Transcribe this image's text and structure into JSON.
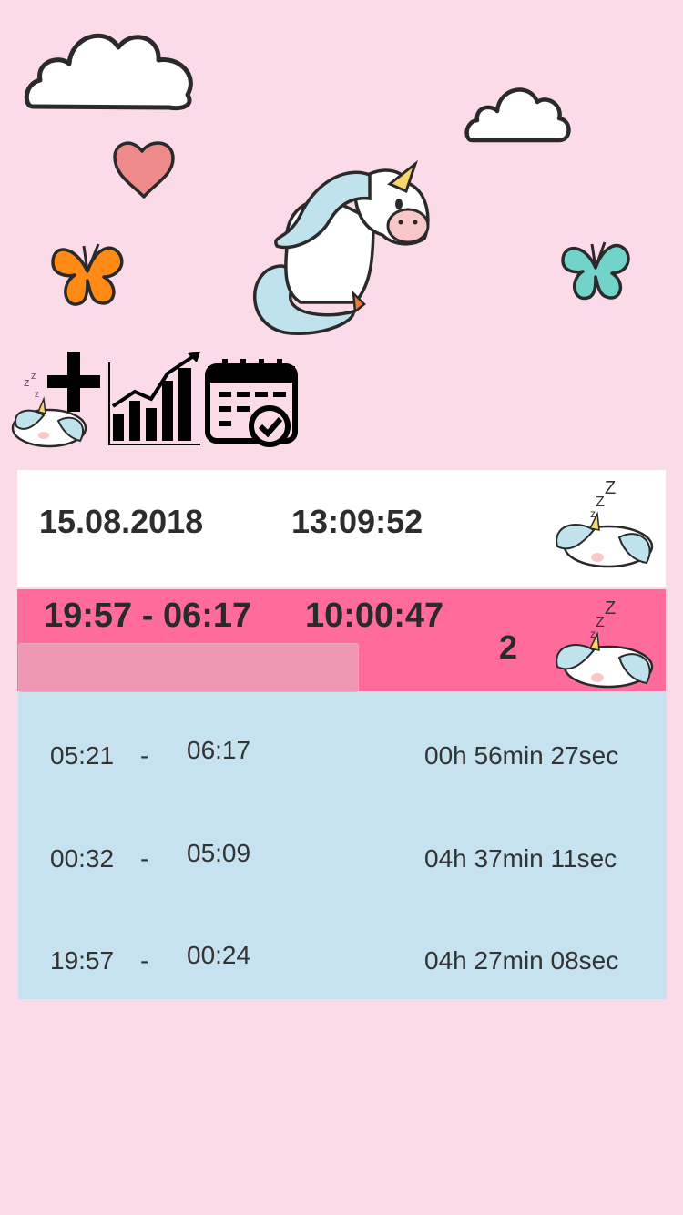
{
  "header": {
    "date": "15.08.2018",
    "time": "13:09:52"
  },
  "summary": {
    "range": "19:57 - 06:17",
    "duration": "10:00:47",
    "count": "2"
  },
  "sessions": [
    {
      "start": "05:21",
      "separator": "-",
      "end": "06:17",
      "duration": "00h 56min 27sec"
    },
    {
      "start": "00:32",
      "separator": "-",
      "end": "05:09",
      "duration": "04h 37min 11sec"
    },
    {
      "start": "19:57",
      "separator": "-",
      "end": "00:24",
      "duration": "04h 27min 08sec"
    }
  ],
  "colors": {
    "background": "#fcdbe8",
    "summary_bg": "#ff6c9c",
    "list_bg": "#c5e2ee"
  },
  "icons": [
    "cloud-icon",
    "heart-icon",
    "butterfly-icon",
    "unicorn-illustration",
    "sleeping-unicorn-icon",
    "plus-icon",
    "chart-icon",
    "calendar-check-icon"
  ]
}
